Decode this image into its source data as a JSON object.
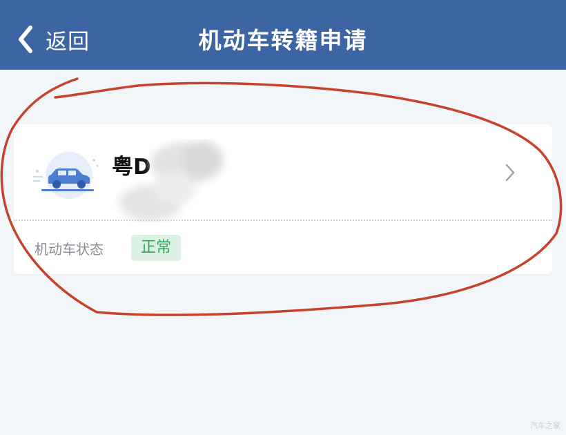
{
  "header": {
    "back_label": "返回",
    "title": "机动车转籍申请"
  },
  "vehicle": {
    "plate": "粤D",
    "status_label": "机动车状态",
    "status_value": "正常"
  },
  "colors": {
    "header_bg": "#3d65a3",
    "page_bg": "#f3f6f8",
    "status_badge_bg": "#dcf1e3",
    "status_badge_text": "#33a35a",
    "annotation_stroke": "#c8412b"
  },
  "icons": {
    "back": "chevron-left-icon",
    "car": "car-icon",
    "arrow": "chevron-right-icon"
  },
  "watermark": "汽车之家"
}
